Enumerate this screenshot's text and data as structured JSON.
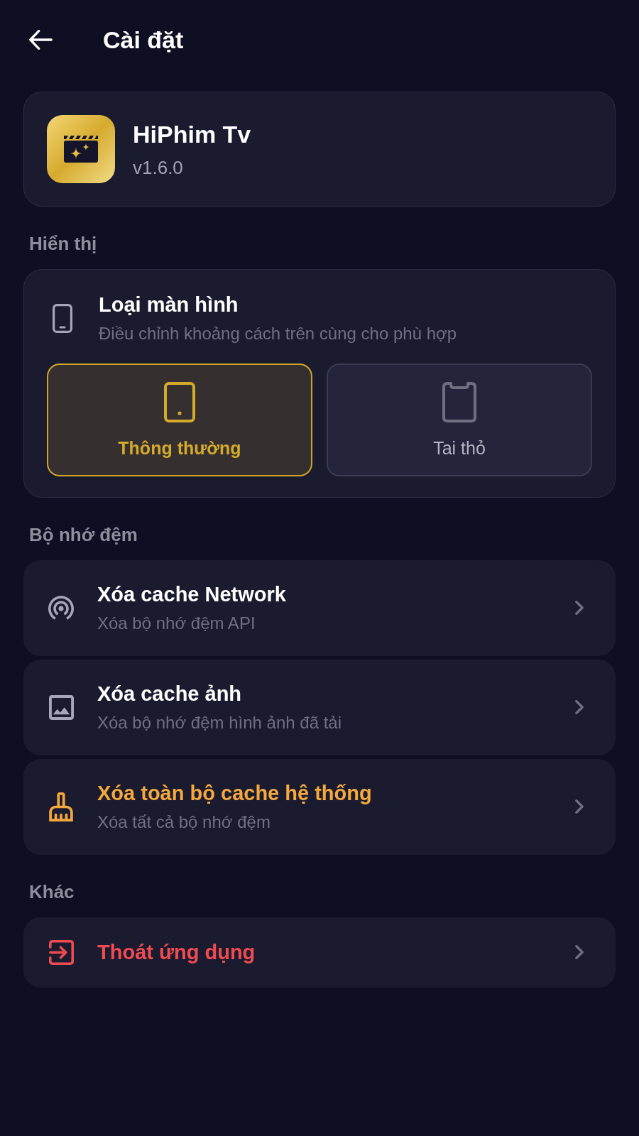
{
  "header": {
    "title": "Cài đặt"
  },
  "app_info": {
    "name": "HiPhim Tv",
    "version": "v1.6.0"
  },
  "sections": [
    {
      "title": "Hiển thị",
      "kind": "screen_type",
      "setting": {
        "title": "Loại màn hình",
        "subtitle": "Điều chỉnh khoảng cách trên cùng cho phù hợp",
        "options": [
          {
            "label": "Thông thường",
            "kind": "normal",
            "selected": true
          },
          {
            "label": "Tai thỏ",
            "kind": "notch",
            "selected": false
          }
        ]
      }
    },
    {
      "title": "Bộ nhớ đệm",
      "kind": "list",
      "items": [
        {
          "title": "Xóa cache Network",
          "subtitle": "Xóa bộ nhớ đệm API",
          "kind": "network",
          "color": "#ffffff",
          "icon": {
            "color": "#a5a6b8"
          }
        },
        {
          "title": "Xóa cache ảnh",
          "subtitle": "Xóa bộ nhớ đệm hình ảnh đã tải",
          "kind": "image",
          "color": "#ffffff",
          "icon": {
            "color": "#a5a6b8"
          }
        },
        {
          "title": "Xóa toàn bộ cache hệ thống",
          "subtitle": "Xóa tất cả bộ nhớ đệm",
          "kind": "broom",
          "color": "#f5a83c",
          "icon": {
            "color": "#f5a83c"
          }
        }
      ]
    },
    {
      "title": "Khác",
      "kind": "list",
      "items": [
        {
          "title": "Thoát ứng dụng",
          "kind": "exit",
          "color": "#ef4b50",
          "icon": {
            "color": "#ef4b50"
          }
        }
      ]
    }
  ]
}
